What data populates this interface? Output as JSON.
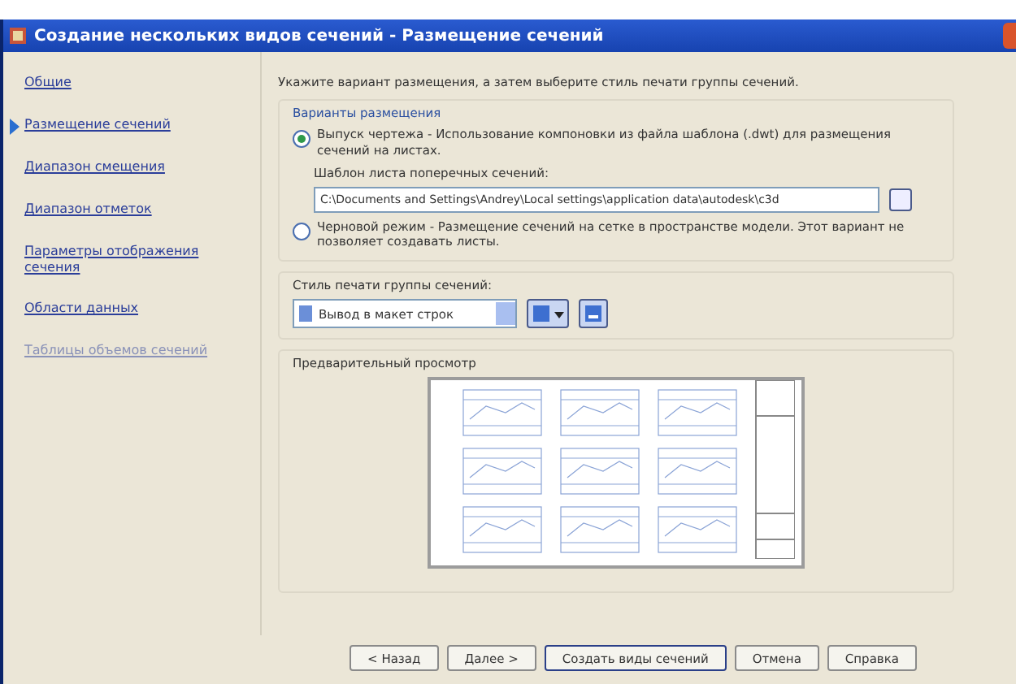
{
  "window": {
    "title": "Создание нескольких видов сечений - Размещение сечений"
  },
  "sidebar": {
    "items": [
      {
        "label": "Общие",
        "selected": false,
        "disabled": false
      },
      {
        "label": "Размещение сечений",
        "selected": true,
        "disabled": false
      },
      {
        "label": "Диапазон смещения",
        "selected": false,
        "disabled": false
      },
      {
        "label": "Диапазон отметок",
        "selected": false,
        "disabled": false
      },
      {
        "label": "Параметры отображения сечения",
        "selected": false,
        "disabled": false
      },
      {
        "label": "Области данных",
        "selected": false,
        "disabled": false
      },
      {
        "label": "Таблицы объемов сечений",
        "selected": false,
        "disabled": true
      }
    ]
  },
  "instruction": "Укажите вариант размещения, а затем выберите стиль печати группы сечений.",
  "placement": {
    "title": "Варианты размещения",
    "options": [
      {
        "label": "Выпуск чертежа - Использование компоновки из файла шаблона (.dwt) для размещения сечений на листах.",
        "selected": true
      },
      {
        "label": "Черновой режим - Размещение сечений на сетке в пространстве модели. Этот вариант не позволяет создавать листы.",
        "selected": false
      }
    ],
    "template_label": "Шаблон листа поперечных сечений:",
    "template_path": "C:\\Documents and Settings\\Andrey\\Local settings\\application data\\autodesk\\c3d"
  },
  "style": {
    "label": "Стиль печати группы сечений:",
    "value": "Вывод в макет строк"
  },
  "preview": {
    "title": "Предварительный просмотр"
  },
  "buttons": [
    "< Назад",
    "Далее >",
    "Создать виды сечений",
    "Отмена",
    "Справка"
  ]
}
